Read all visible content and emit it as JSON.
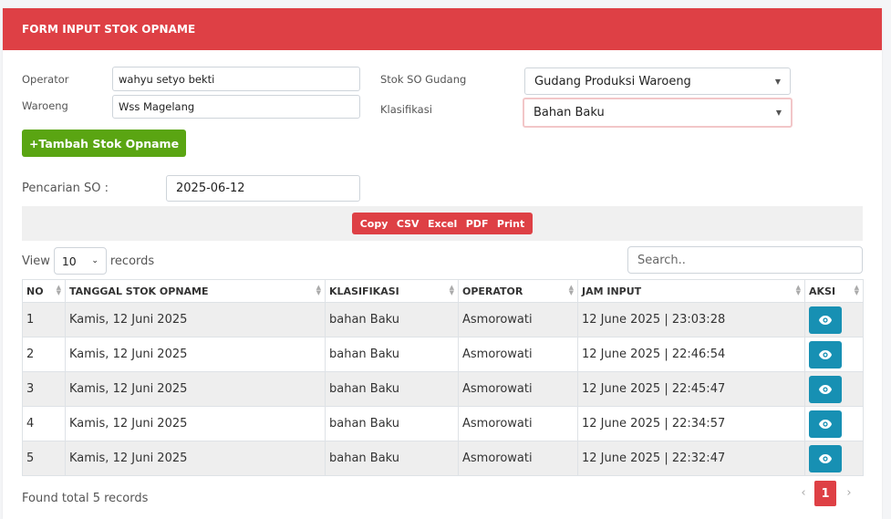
{
  "header": {
    "title": "FORM INPUT STOK OPNAME"
  },
  "form": {
    "operator_label": "Operator",
    "operator_value": "wahyu setyo bekti",
    "waroeng_label": "Waroeng",
    "waroeng_value": "Wss Magelang",
    "gudang_label": "Stok SO Gudang",
    "gudang_value": "Gudang Produksi Waroeng",
    "klasifikasi_label": "Klasifikasi",
    "klasifikasi_value": "Bahan Baku",
    "add_button": "+Tambah Stok Opname",
    "search_so_label": "Pencarian SO :",
    "search_so_value": "2025-06-12"
  },
  "export": {
    "copy": "Copy",
    "csv": "CSV",
    "excel": "Excel",
    "pdf": "PDF",
    "print": "Print"
  },
  "table_controls": {
    "view": "View",
    "length": "10",
    "records": "records",
    "search_placeholder": "Search.."
  },
  "table": {
    "headers": [
      "NO",
      "TANGGAL STOK OPNAME",
      "KLASIFIKASI",
      "OPERATOR",
      "JAM INPUT",
      "AKSI"
    ],
    "rows": [
      [
        "1",
        "Kamis, 12 Juni 2025",
        "bahan Baku",
        "Asmorowati",
        "12 June 2025 | 23:03:28"
      ],
      [
        "2",
        "Kamis, 12 Juni 2025",
        "bahan Baku",
        "Asmorowati",
        "12 June 2025 | 22:46:54"
      ],
      [
        "3",
        "Kamis, 12 Juni 2025",
        "bahan Baku",
        "Asmorowati",
        "12 June 2025 | 22:45:47"
      ],
      [
        "4",
        "Kamis, 12 Juni 2025",
        "bahan Baku",
        "Asmorowati",
        "12 June 2025 | 22:34:57"
      ],
      [
        "5",
        "Kamis, 12 Juni 2025",
        "bahan Baku",
        "Asmorowati",
        "12 June 2025 | 22:32:47"
      ]
    ]
  },
  "footer": {
    "found": "Found total 5 records",
    "page": "1",
    "prev": "‹",
    "next": "›"
  },
  "icons": {
    "row_action": "eye-icon",
    "sort": "sort-icon",
    "dropdown": "caret-down-icon"
  },
  "colors": {
    "header": "#de4045",
    "add_button": "#5aa512",
    "action_button": "#1790b3"
  }
}
